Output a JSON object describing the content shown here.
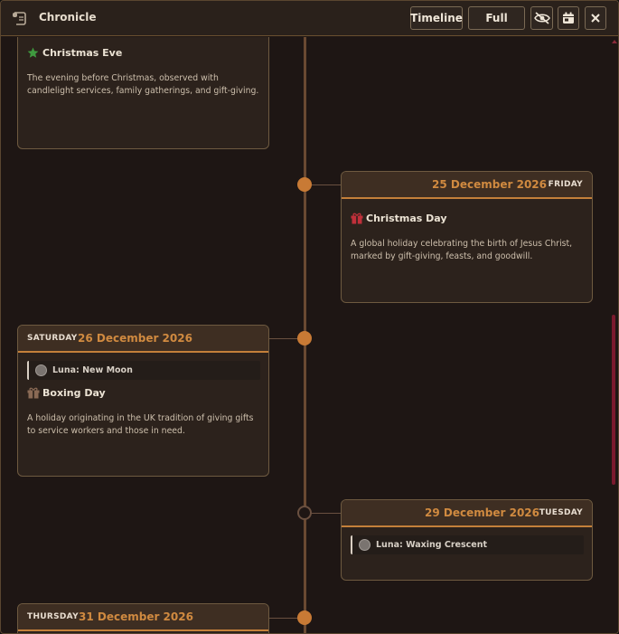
{
  "window": {
    "title": "Chronicle"
  },
  "toolbar": {
    "timeline_label": "Timeline",
    "full_label": "Full",
    "icons": [
      "scroll-icon",
      "eye-slash-icon",
      "calendar-icon",
      "close-icon"
    ]
  },
  "colors": {
    "accent": "#c87a35",
    "background": "#1e1614",
    "card": "#2c221c",
    "scrollbar": "#7a1a2e"
  },
  "entries": [
    {
      "side": "left",
      "date": "",
      "weekday": "",
      "events": [
        {
          "icon": "star-icon",
          "title": "Christmas Eve",
          "description": "The evening before Christmas, observed with candlelight services, family gatherings, and gift-giving."
        }
      ]
    },
    {
      "side": "right",
      "date": "25 December 2026",
      "weekday": "FRIDAY",
      "events": [
        {
          "icon": "gift-icon",
          "title": "Christmas Day",
          "description": "A global holiday celebrating the birth of Jesus Christ, marked by gift-giving, feasts, and goodwill."
        }
      ]
    },
    {
      "side": "left",
      "date": "26 December 2026",
      "weekday": "SATURDAY",
      "moon": "Luna: New Moon",
      "events": [
        {
          "icon": "gift-icon",
          "title": "Boxing Day",
          "description": "A holiday originating in the UK tradition of giving gifts to service workers and those in need."
        }
      ]
    },
    {
      "side": "right",
      "date": "29 December 2026",
      "weekday": "TUESDAY",
      "moon": "Luna: Waxing Crescent",
      "events": []
    },
    {
      "side": "left",
      "date": "31 December 2026",
      "weekday": "THURSDAY",
      "events": []
    }
  ]
}
